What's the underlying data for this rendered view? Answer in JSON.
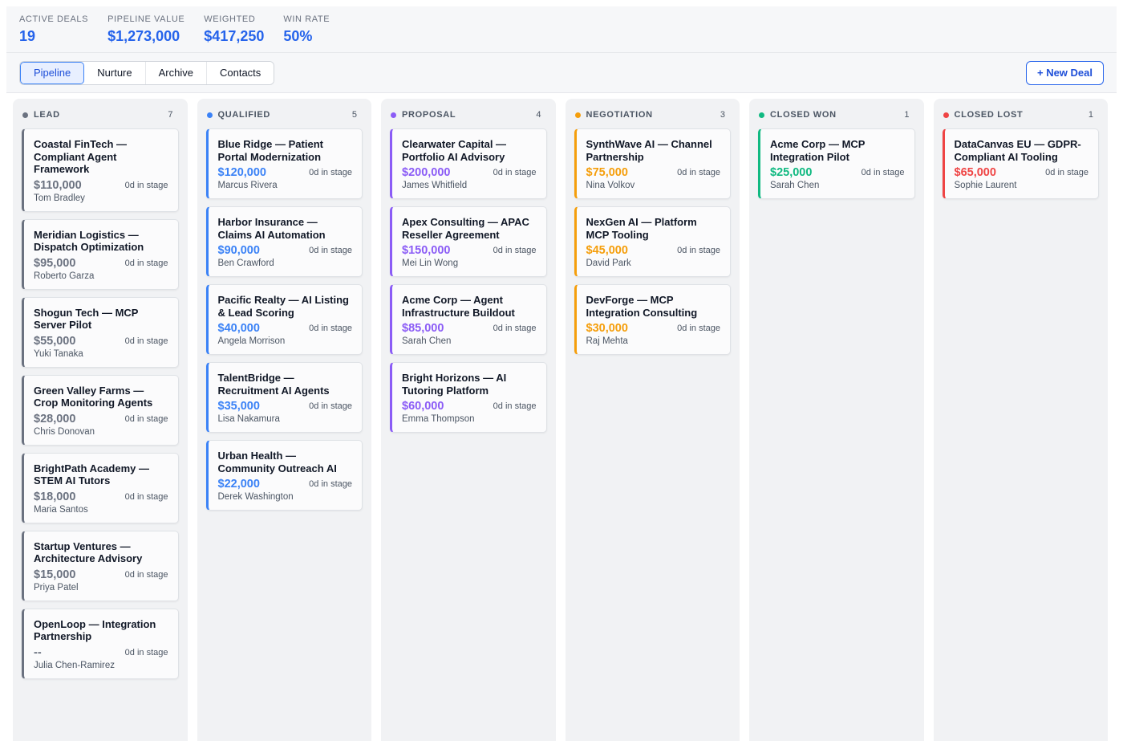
{
  "stats": [
    {
      "label": "ACTIVE DEALS",
      "value": "19"
    },
    {
      "label": "PIPELINE VALUE",
      "value": "$1,273,000"
    },
    {
      "label": "WEIGHTED",
      "value": "$417,250"
    },
    {
      "label": "WIN RATE",
      "value": "50%"
    }
  ],
  "tabs": [
    {
      "label": "Pipeline",
      "active": true
    },
    {
      "label": "Nurture",
      "active": false
    },
    {
      "label": "Archive",
      "active": false
    },
    {
      "label": "Contacts",
      "active": false
    }
  ],
  "actions": {
    "new_deal_label": "+ New Deal"
  },
  "colors": {
    "lead": "#6b7280",
    "qualified": "#3b82f6",
    "proposal": "#8b5cf6",
    "negotiation": "#f59e0b",
    "closed_won": "#10b981",
    "closed_lost": "#ef4444"
  },
  "columns": [
    {
      "key": "lead",
      "title": "LEAD",
      "count": "7",
      "color": "#6b7280",
      "value_color": "#6b7280",
      "cards": [
        {
          "title": "Coastal FinTech — Compliant Agent Framework",
          "value": "$110,000",
          "stage": "0d in stage",
          "owner": "Tom Bradley"
        },
        {
          "title": "Meridian Logistics — Dispatch Optimization",
          "value": "$95,000",
          "stage": "0d in stage",
          "owner": "Roberto Garza"
        },
        {
          "title": "Shogun Tech — MCP Server Pilot",
          "value": "$55,000",
          "stage": "0d in stage",
          "owner": "Yuki Tanaka"
        },
        {
          "title": "Green Valley Farms — Crop Monitoring Agents",
          "value": "$28,000",
          "stage": "0d in stage",
          "owner": "Chris Donovan"
        },
        {
          "title": "BrightPath Academy — STEM AI Tutors",
          "value": "$18,000",
          "stage": "0d in stage",
          "owner": "Maria Santos"
        },
        {
          "title": "Startup Ventures — Architecture Advisory",
          "value": "$15,000",
          "stage": "0d in stage",
          "owner": "Priya Patel"
        },
        {
          "title": "OpenLoop — Integration Partnership",
          "value": "--",
          "stage": "0d in stage",
          "owner": "Julia Chen-Ramirez"
        }
      ]
    },
    {
      "key": "qualified",
      "title": "QUALIFIED",
      "count": "5",
      "color": "#3b82f6",
      "value_color": "#3b82f6",
      "cards": [
        {
          "title": "Blue Ridge — Patient Portal Modernization",
          "value": "$120,000",
          "stage": "0d in stage",
          "owner": "Marcus Rivera"
        },
        {
          "title": "Harbor Insurance — Claims AI Automation",
          "value": "$90,000",
          "stage": "0d in stage",
          "owner": "Ben Crawford"
        },
        {
          "title": "Pacific Realty — AI Listing & Lead Scoring",
          "value": "$40,000",
          "stage": "0d in stage",
          "owner": "Angela Morrison"
        },
        {
          "title": "TalentBridge — Recruitment AI Agents",
          "value": "$35,000",
          "stage": "0d in stage",
          "owner": "Lisa Nakamura"
        },
        {
          "title": "Urban Health — Community Outreach AI",
          "value": "$22,000",
          "stage": "0d in stage",
          "owner": "Derek Washington"
        }
      ]
    },
    {
      "key": "proposal",
      "title": "PROPOSAL",
      "count": "4",
      "color": "#8b5cf6",
      "value_color": "#8b5cf6",
      "cards": [
        {
          "title": "Clearwater Capital — Portfolio AI Advisory",
          "value": "$200,000",
          "stage": "0d in stage",
          "owner": "James Whitfield"
        },
        {
          "title": "Apex Consulting — APAC Reseller Agreement",
          "value": "$150,000",
          "stage": "0d in stage",
          "owner": "Mei Lin Wong"
        },
        {
          "title": "Acme Corp — Agent Infrastructure Buildout",
          "value": "$85,000",
          "stage": "0d in stage",
          "owner": "Sarah Chen"
        },
        {
          "title": "Bright Horizons — AI Tutoring Platform",
          "value": "$60,000",
          "stage": "0d in stage",
          "owner": "Emma Thompson"
        }
      ]
    },
    {
      "key": "negotiation",
      "title": "NEGOTIATION",
      "count": "3",
      "color": "#f59e0b",
      "value_color": "#f59e0b",
      "cards": [
        {
          "title": "SynthWave AI — Channel Partnership",
          "value": "$75,000",
          "stage": "0d in stage",
          "owner": "Nina Volkov"
        },
        {
          "title": "NexGen AI — Platform MCP Tooling",
          "value": "$45,000",
          "stage": "0d in stage",
          "owner": "David Park"
        },
        {
          "title": "DevForge — MCP Integration Consulting",
          "value": "$30,000",
          "stage": "0d in stage",
          "owner": "Raj Mehta"
        }
      ]
    },
    {
      "key": "closed_won",
      "title": "CLOSED WON",
      "count": "1",
      "color": "#10b981",
      "value_color": "#10b981",
      "cards": [
        {
          "title": "Acme Corp — MCP Integration Pilot",
          "value": "$25,000",
          "stage": "0d in stage",
          "owner": "Sarah Chen"
        }
      ]
    },
    {
      "key": "closed_lost",
      "title": "CLOSED LOST",
      "count": "1",
      "color": "#ef4444",
      "value_color": "#ef4444",
      "cards": [
        {
          "title": "DataCanvas EU — GDPR-Compliant AI Tooling",
          "value": "$65,000",
          "stage": "0d in stage",
          "owner": "Sophie Laurent"
        }
      ]
    }
  ]
}
